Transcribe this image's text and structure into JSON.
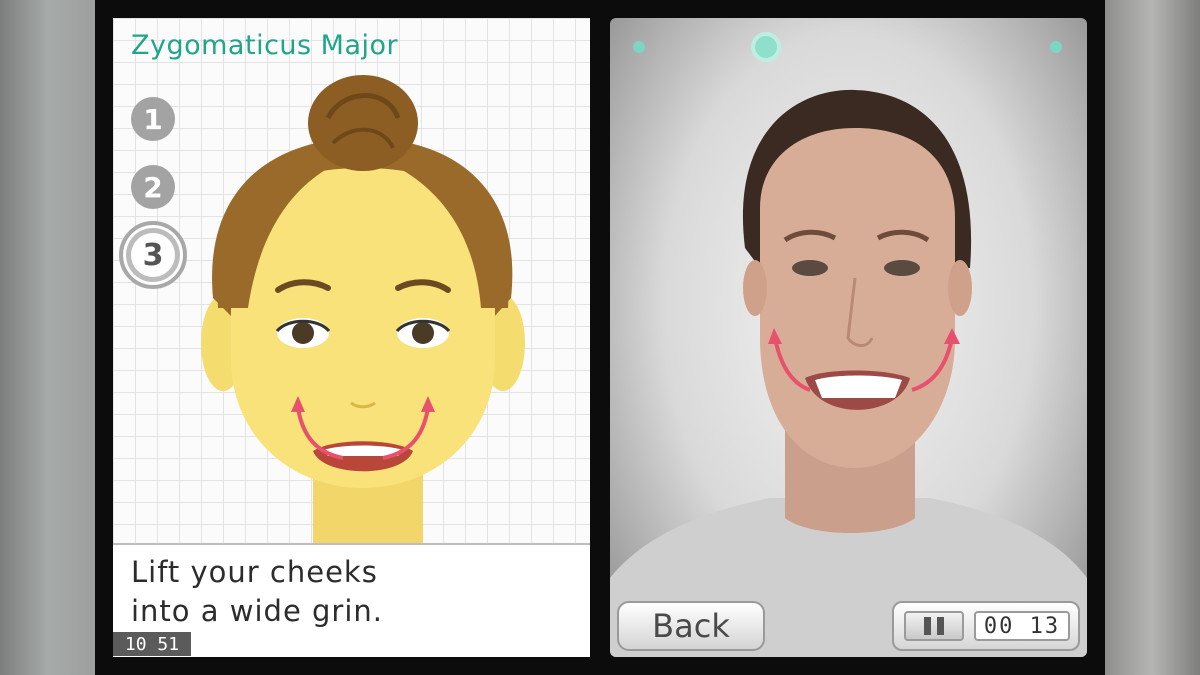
{
  "left_screen": {
    "title": "Zygomaticus Major",
    "steps": [
      "1",
      "2",
      "3"
    ],
    "active_step": 3,
    "instruction_line1": "Lift your cheeks",
    "instruction_line2": "into a wide grin.",
    "clock": "10 51"
  },
  "right_screen": {
    "back_label": "Back",
    "timer": "00 13"
  },
  "colors": {
    "title": "#1fa58a",
    "arrow": "#e8516d",
    "indicator_dot": "#7dd6c1"
  },
  "icons": [
    "pause-icon",
    "smile-arrow-icon",
    "indicator-dot-icon"
  ]
}
